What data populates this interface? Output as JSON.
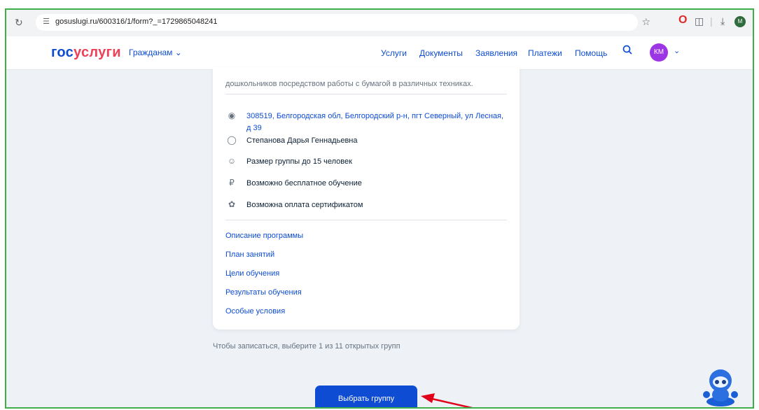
{
  "browser": {
    "url": "gosuslugi.ru/600316/1/form?_=1729865048241",
    "profile_initial": "M"
  },
  "header": {
    "logo_part1": "гос",
    "logo_part2": "услуги",
    "audience_label": "Гражданам",
    "nav": [
      "Услуги",
      "Документы",
      "Заявления",
      "Платежи",
      "Помощь"
    ],
    "avatar_initials": "КМ"
  },
  "card": {
    "description": "дошкольников посредством работы с бумагой в различных техниках.",
    "address": "308519, Белгородская обл, Белгородский р-н, пгт Северный, ул Лесная, д 39",
    "teacher": "Степанова Дарья Геннадьевна",
    "group_size": "Размер группы до 15 человек",
    "free_option": "Возможно бесплатное обучение",
    "certificate_option": "Возможна оплата сертификатом",
    "links": [
      "Описание программы",
      "План занятий",
      "Цели обучения",
      "Результаты обучения",
      "Особые условия"
    ]
  },
  "hint": "Чтобы записаться, выберите 1 из 11 открытых групп",
  "cta_label": "Выбрать группу",
  "colors": {
    "brand_blue": "#0d4cd3",
    "brand_red": "#ee3f58",
    "avatar_purple": "#9c35e3",
    "frame_green": "#3fae49",
    "arrow_red": "#e0001a"
  }
}
